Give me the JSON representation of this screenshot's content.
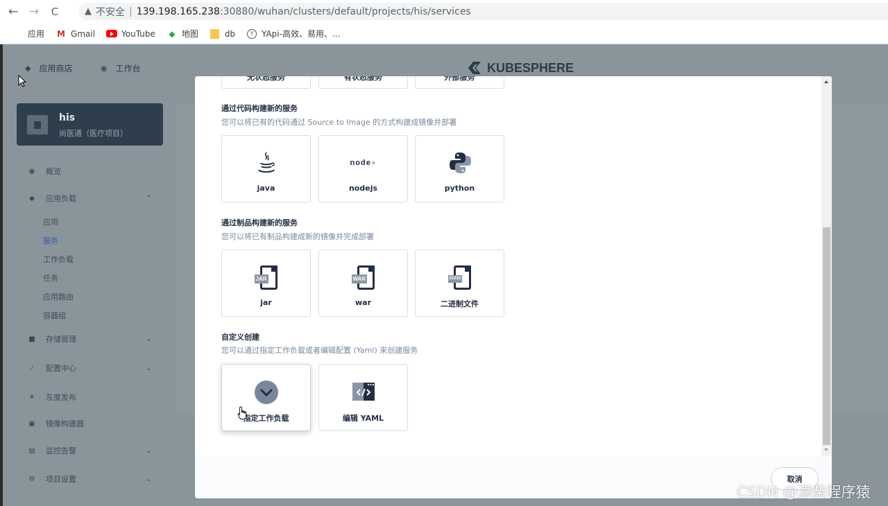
{
  "browser": {
    "back": "←",
    "forward": "→",
    "reload": "C",
    "security_label": "不安全",
    "url_host": "139.198.165.238",
    "url_path": ":30880/wuhan/clusters/default/projects/his/services",
    "bookmarks": [
      "应用",
      "Gmail",
      "YouTube",
      "地图",
      "db",
      "YApi-高效、易用、..."
    ]
  },
  "header": {
    "nav": [
      "应用商店",
      "工作台"
    ],
    "brand": "KUBESPHERE"
  },
  "project": {
    "name": "his",
    "desc": "尚医通（医疗项目）"
  },
  "sidebar": {
    "items": [
      {
        "label": "概览",
        "icon": "overview-icon"
      },
      {
        "label": "应用负载",
        "icon": "workload-icon",
        "expanded": true
      },
      {
        "label": "存储管理",
        "icon": "storage-icon"
      },
      {
        "label": "配置中心",
        "icon": "config-icon"
      },
      {
        "label": "灰度发布",
        "icon": "grayscale-icon"
      },
      {
        "label": "镜像构建器",
        "icon": "image-builder-icon"
      },
      {
        "label": "监控告警",
        "icon": "monitoring-icon"
      },
      {
        "label": "项目设置",
        "icon": "settings-icon"
      }
    ],
    "sub": [
      "应用",
      "服务",
      "工作负载",
      "任务",
      "应用路由",
      "容器组"
    ],
    "active_sub": "服务"
  },
  "modal": {
    "top_partial": [
      "无状态服务",
      "有状态服务",
      "外部服务"
    ],
    "sections": [
      {
        "title": "通过代码构建新的服务",
        "desc": "您可以将已有的代码通过 Source to Image 的方式构建成镜像并部署",
        "cards": [
          {
            "label": "java",
            "icon": "java-icon"
          },
          {
            "label": "nodejs",
            "icon": "nodejs-icon",
            "logo_text": "node"
          },
          {
            "label": "python",
            "icon": "python-icon"
          }
        ]
      },
      {
        "title": "通过制品构建新的服务",
        "desc": "您可以将已有制品构建成新的镜像并完成部署",
        "cards": [
          {
            "label": "jar",
            "icon": "jar-file-icon",
            "tag": "JAR"
          },
          {
            "label": "war",
            "icon": "war-file-icon",
            "tag": "WAR"
          },
          {
            "label": "二进制文件",
            "icon": "binary-file-icon",
            "tag": "01010"
          }
        ]
      },
      {
        "title": "自定义创建",
        "desc": "您可以通过指定工作负载或者编辑配置 (Yaml) 来创建服务",
        "cards": [
          {
            "label": "指定工作负载",
            "icon": "workload-select-icon"
          },
          {
            "label": "编辑 YAML",
            "icon": "yaml-code-icon"
          }
        ]
      }
    ],
    "cancel": "取消"
  },
  "watermark": "CSDN @添柴程序猿",
  "colors": {
    "mask": "#8a949b",
    "accent": "#242e42",
    "project_card": "#2f3e4c"
  }
}
